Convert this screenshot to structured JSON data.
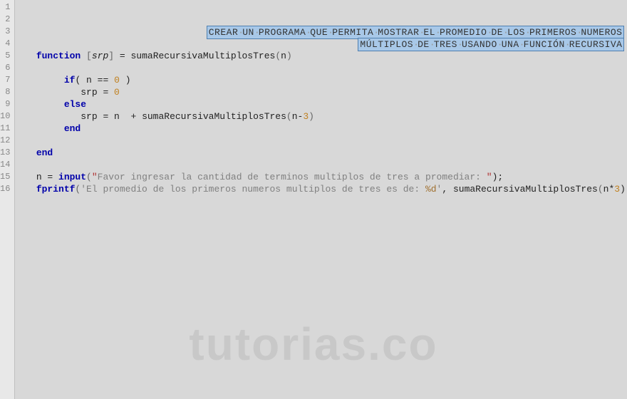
{
  "gutter": {
    "lines": [
      1,
      2,
      3,
      4,
      5,
      6,
      7,
      8,
      9,
      10,
      11,
      12,
      13,
      14,
      15,
      16
    ]
  },
  "code": {
    "comment_line1": "CREAR UN PROGRAMA QUE PERMITA MOSTRAR EL PROMEDIO DE LOS PRIMEROS NUMEROS",
    "comment_line2": "MÚLTIPLOS DE TRES USANDO UNA FUNCIÓN RECURSIVA",
    "t_function": "function",
    "t_srp": "srp",
    "t_eq": " = ",
    "t_funcname": "sumaRecursivaMultiplosTres",
    "t_n": "n",
    "t_if": "if",
    "t_cond_open": "( ",
    "t_eqeq": " == ",
    "t_zero": "0",
    "t_cond_close": " )",
    "t_srp_assign": "srp = ",
    "t_else": "else",
    "t_srp_assign2": "srp = n  + ",
    "t_minus": "-",
    "t_three": "3",
    "t_end": "end",
    "t_input_lhs": "n = ",
    "t_input": "input",
    "t_quote": "\"",
    "t_input_str": "Favor ingresar la cantidad de terminos multiplos de tres a promediar: ",
    "t_input_tail": ");",
    "t_fprintf": "fprintf",
    "t_squote": "'",
    "t_fprintf_str": "El promedio de los primeros numeros multiplos de tres es de: ",
    "t_fmt": "%d",
    "t_fprintf_mid": ", ",
    "t_mult": "*",
    "t_div_n": ") / n );"
  },
  "watermark": "tutorias.co"
}
